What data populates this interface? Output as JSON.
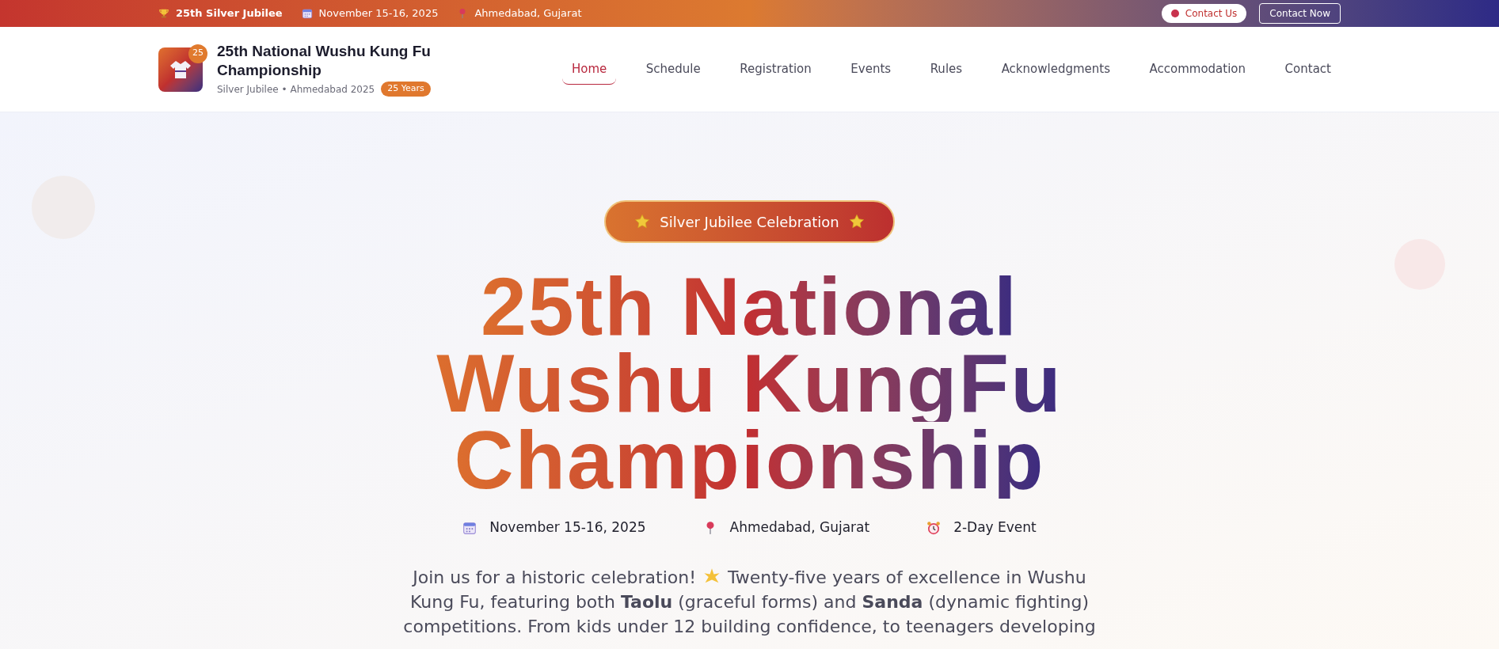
{
  "top_bar": {
    "items": [
      {
        "kind": "trophy",
        "text": "25th Silver Jubilee"
      },
      {
        "kind": "calendar",
        "text": "November 15-16, 2025"
      },
      {
        "kind": "pin",
        "text": "Ahmedabad, Gujarat"
      }
    ],
    "buttons": [
      {
        "kind": "pill",
        "text": "Contact Us"
      },
      {
        "kind": "outline",
        "text": "Contact Now"
      }
    ]
  },
  "header": {
    "logo_badge": "25",
    "title": "25th National Wushu Kung Fu Championship",
    "subtitle": "Silver Jubilee • Ahmedabad 2025",
    "years_badge": "25 Years",
    "nav": [
      {
        "label": "Home",
        "selected": true
      },
      {
        "label": "Schedule",
        "selected": false
      },
      {
        "label": "Registration",
        "selected": false
      },
      {
        "label": "Events",
        "selected": false
      },
      {
        "label": "Rules",
        "selected": false
      },
      {
        "label": "Acknowledgments",
        "selected": false
      },
      {
        "label": "Accommodation",
        "selected": false
      },
      {
        "label": "Contact",
        "selected": false
      }
    ]
  },
  "hero": {
    "badge": "Silver Jubilee Celebration",
    "title_lines": [
      "25th National",
      "Wushu KungFu",
      "Championship"
    ],
    "meta": [
      {
        "kind": "calendar",
        "text": "November 15-16, 2025"
      },
      {
        "kind": "pin",
        "text": "Ahmedabad, Gujarat"
      },
      {
        "kind": "alarm",
        "text": "2-Day Event"
      }
    ],
    "intro_start": "Join us for a historic celebration!",
    "intro_rest": "Twenty-five years of excellence in Wushu",
    "intro_more": "Kung Fu, featuring both **Taolu** (graceful forms) and **Sanda** (dynamic fighting) competitions. From kids under 12 building confidence, to teenagers developing"
  }
}
